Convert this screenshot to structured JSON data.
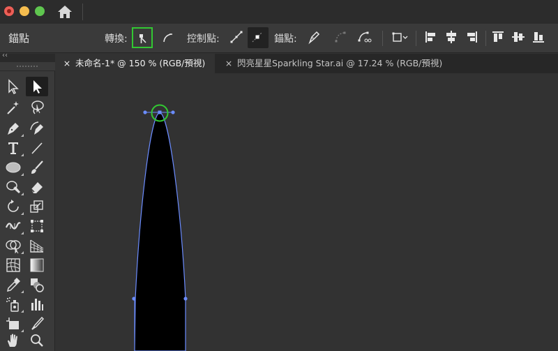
{
  "window": {
    "home_icon": "home-icon"
  },
  "control_bar": {
    "title": "錨點",
    "convert_label": "轉換:",
    "handles_label": "控制點:",
    "anchors_label": "錨點:",
    "active_highlight_color": "#32c832"
  },
  "toolbox": {
    "collapse_glyph": "‹‹",
    "tools": [
      "selection-tool",
      "direct-selection-tool",
      "magic-wand-tool",
      "lasso-tool",
      "pen-tool",
      "curvature-tool",
      "type-tool",
      "line-segment-tool",
      "ellipse-tool",
      "paintbrush-tool",
      "shaper-tool",
      "eraser-tool",
      "rotate-tool",
      "scale-tool",
      "width-tool",
      "free-transform-tool",
      "shape-builder-tool",
      "perspective-grid-tool",
      "mesh-tool",
      "gradient-tool",
      "eyedropper-tool",
      "blend-tool",
      "symbol-sprayer-tool",
      "column-graph-tool",
      "artboard-tool",
      "slice-tool",
      "hand-tool",
      "zoom-tool"
    ]
  },
  "tabs": [
    {
      "label": "未命名-1* @ 150 % (RGB/預視)",
      "close": "×",
      "active": true
    },
    {
      "label": "閃亮星星Sparkling Star.ai @ 17.24 % (RGB/預視)",
      "close": "×",
      "active": false
    }
  ],
  "canvas": {
    "path_color": "#6b8cff",
    "fill_color": "#000000",
    "anchor_highlight_color": "#32c832"
  }
}
